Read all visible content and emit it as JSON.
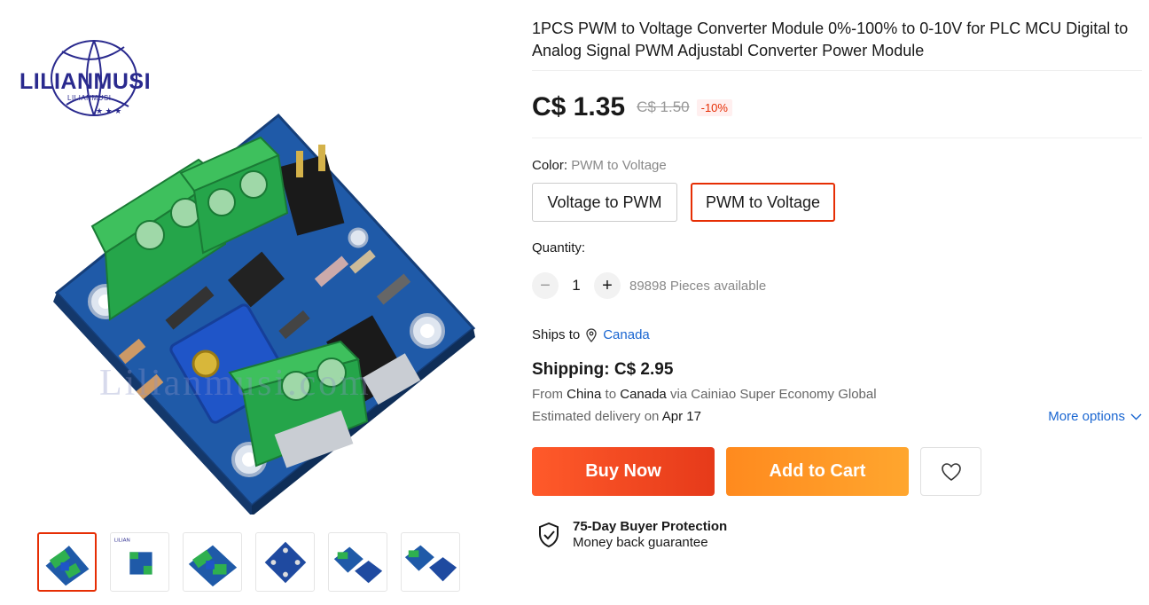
{
  "brand": {
    "logo_text": "LILIANMUSI",
    "logo_subtext": "LILIANMUSI",
    "watermark": "Lilianmusi.com"
  },
  "gallery": {
    "thumbnail_count": 6
  },
  "product": {
    "title": "1PCS PWM to Voltage Converter Module 0%-100% to 0-10V for PLC MCU Digital to Analog Signal PWM Adjustabl Converter Power Module",
    "price": "C$ 1.35",
    "original_price": "C$ 1.50",
    "discount": "-10%"
  },
  "variant": {
    "label": "Color: ",
    "selected": "PWM to Voltage",
    "options": [
      "Voltage to PWM",
      "PWM to Voltage"
    ]
  },
  "quantity": {
    "label": "Quantity:",
    "value": "1",
    "minus": "−",
    "plus": "+",
    "available": "89898 Pieces available"
  },
  "shipping": {
    "ships_to_label": "Ships to",
    "ships_to_country": "Canada",
    "cost": "Shipping: C$ 2.95",
    "from_word": "From",
    "from_country": "China",
    "to_word": "to",
    "to_country": "Canada",
    "via": "via Cainiao Super Economy Global",
    "delivery_label": "Estimated delivery on",
    "delivery_date": "Apr 17",
    "more_options": "More options"
  },
  "actions": {
    "buy_now": "Buy Now",
    "add_to_cart": "Add to Cart"
  },
  "protection": {
    "title": "75-Day Buyer Protection",
    "subtitle": "Money back guarantee"
  },
  "colors": {
    "accent_red": "#e62e04",
    "buy_now": "#ff5a2a",
    "add_to_cart": "#ffa62e",
    "link_blue": "#1a66d1"
  },
  "icons": [
    "location-pin-icon",
    "chevron-down-icon",
    "heart-icon",
    "shield-check-icon"
  ]
}
